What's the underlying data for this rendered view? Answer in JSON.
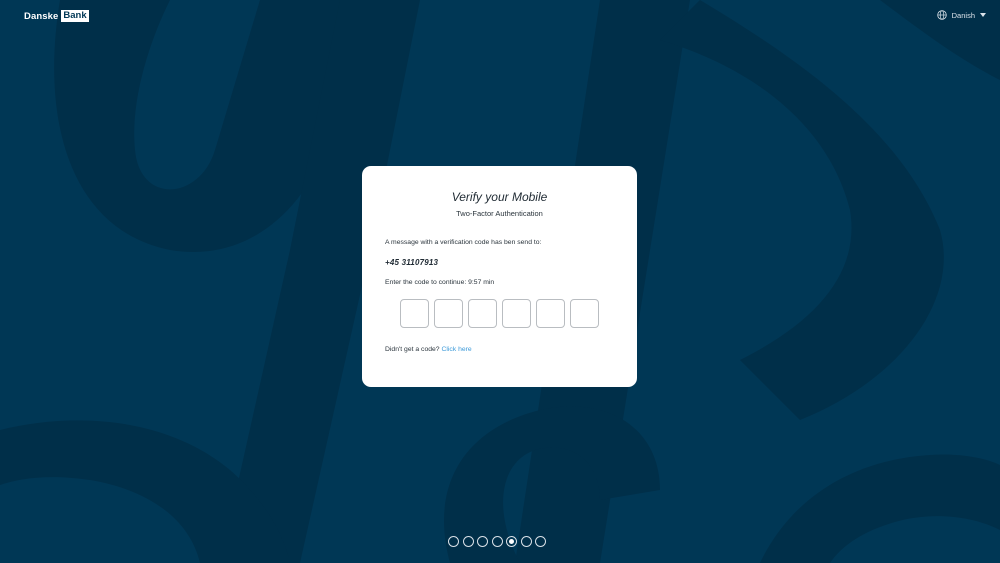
{
  "header": {
    "logo_word": "Danske",
    "logo_box": "Bank",
    "language": "Danish",
    "language_icon": "globe-icon"
  },
  "card": {
    "title": "Verify your Mobile",
    "subtitle": "Two-Factor Authentication",
    "message": "A message with a verification code has ben send to:",
    "phone": "+45 31107913",
    "enter_label": "Enter the code to continue:",
    "timer": "9:57 min",
    "code_digits": [
      "",
      "",
      "",
      "",
      "",
      ""
    ],
    "resend_text": "Didn't get a code?",
    "resend_link": "Click here"
  },
  "pagination": {
    "total": 7,
    "active_index": 4
  },
  "colors": {
    "background": "#003755",
    "background_shape": "#002f49",
    "link": "#3c9ad9"
  }
}
